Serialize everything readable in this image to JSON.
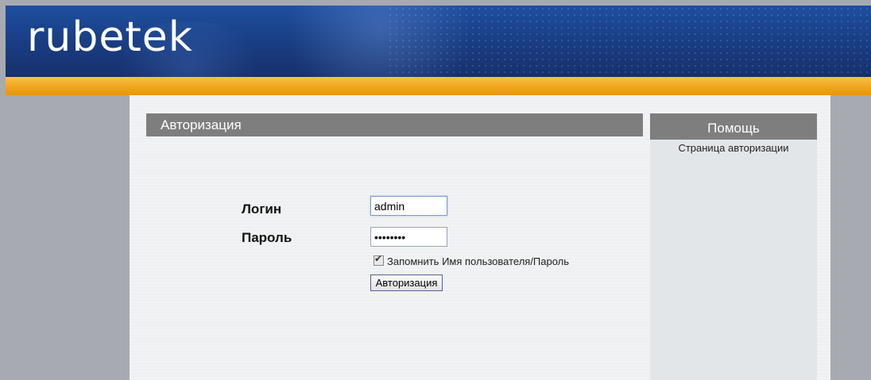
{
  "header": {
    "logo_text": "rubetek"
  },
  "auth_panel": {
    "title": "Авторизация",
    "login_label": "Логин",
    "login_value": "admin",
    "password_label": "Пароль",
    "password_value": "••••••••",
    "remember_label": "Запомнить Имя пользователя/Пароль",
    "remember_checked": true,
    "submit_label": "Авторизация"
  },
  "help_panel": {
    "title": "Помощь",
    "text": "Страница авторизации"
  },
  "colors": {
    "header_blue": "#1a3f86",
    "accent_orange": "#f0a31a",
    "panel_gray": "#7e7e7e"
  }
}
